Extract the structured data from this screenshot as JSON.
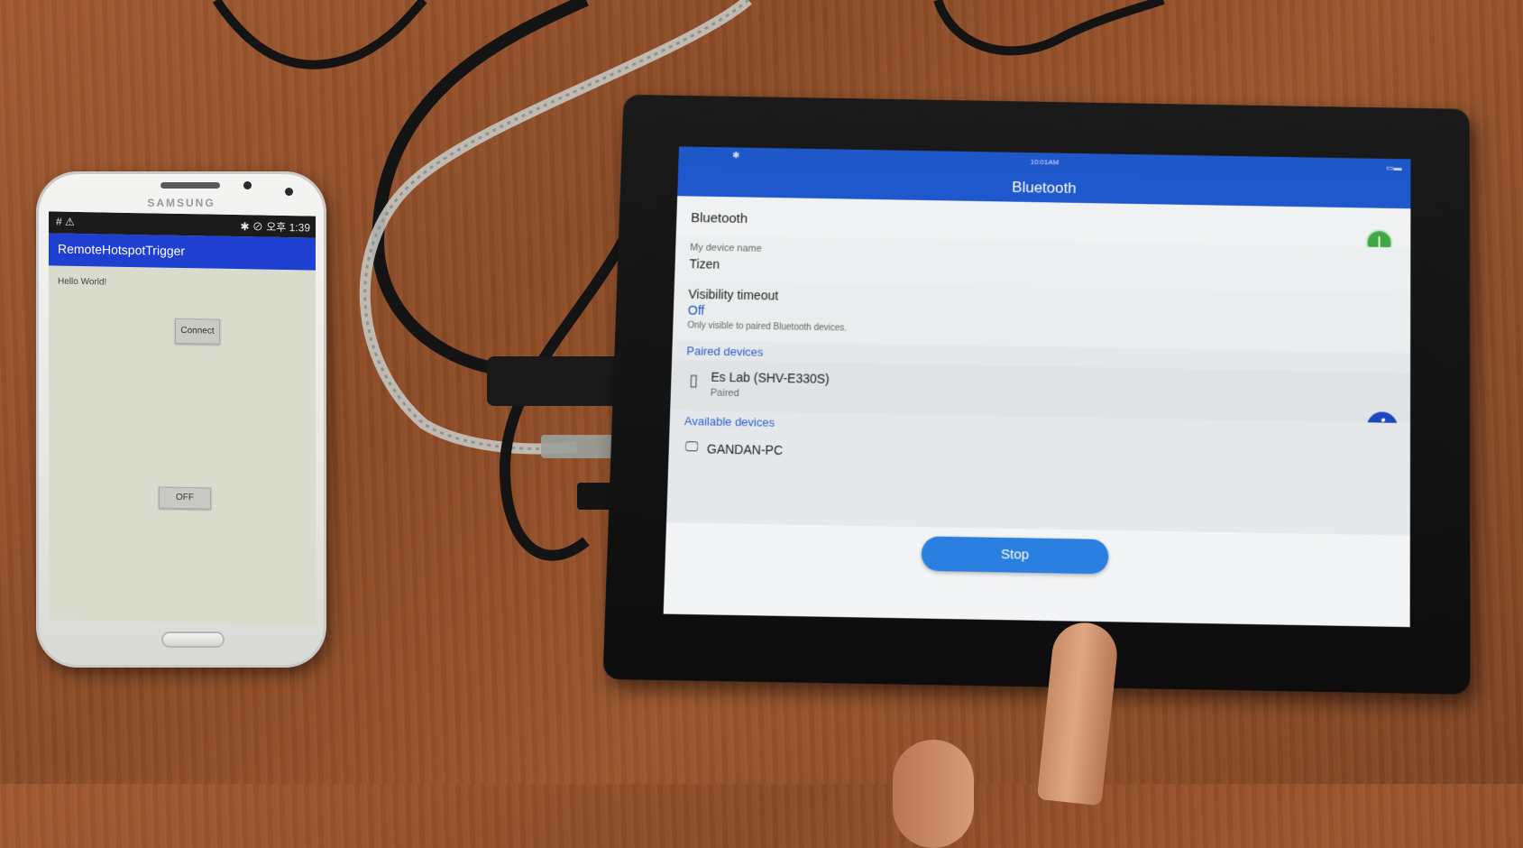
{
  "phone": {
    "brand": "SAMSUNG",
    "status": {
      "left": "# ⚠",
      "right": "✱ ⊘ 오후 1:39"
    },
    "app_title": "RemoteHotspotTrigger",
    "hello": "Hello World!",
    "connect_button": "Connect",
    "off_button": "OFF"
  },
  "tablet": {
    "status_time": "10:01AM",
    "title": "Bluetooth",
    "bluetooth_label": "Bluetooth",
    "bluetooth_enabled": true,
    "device_name_caption": "My device name",
    "device_name": "Tizen",
    "visibility_label": "Visibility timeout",
    "visibility_value": "Off",
    "visibility_hint": "Only visible to paired Bluetooth devices.",
    "paired_header": "Paired devices",
    "paired_devices": [
      {
        "name": "Es Lab (SHV-E330S)",
        "status": "Paired",
        "icon": "phone-icon"
      }
    ],
    "available_header": "Available devices",
    "available_devices": [
      {
        "name": "GANDAN-PC",
        "icon": "monitor-icon"
      }
    ],
    "stop_button": "Stop"
  },
  "colors": {
    "accent": "#1f58cc",
    "toggle_on": "#3fa844",
    "stop_button": "#2a7fe0",
    "phone_appbar": "#1f3fd0"
  }
}
